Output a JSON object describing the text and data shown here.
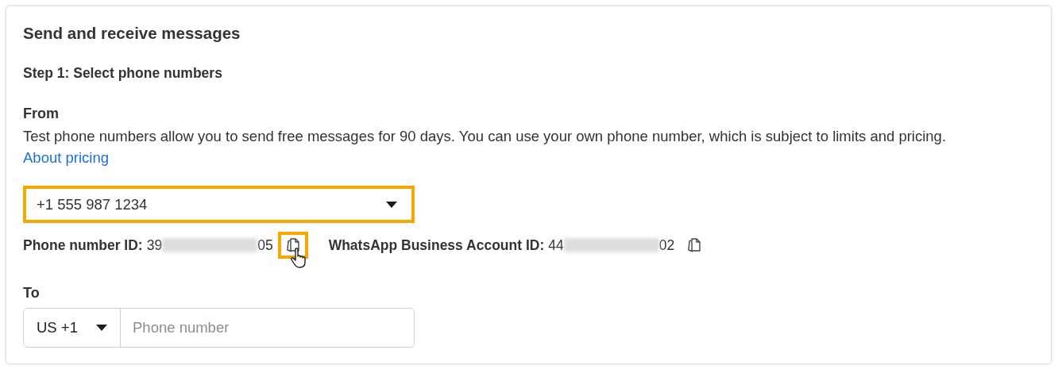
{
  "section": {
    "title": "Send and receive messages"
  },
  "step": "Step 1: Select phone numbers",
  "from": {
    "label": "From",
    "description": "Test phone numbers allow you to send free messages for 90 days. You can use your own phone number, which is subject to limits and pricing.",
    "link": "About pricing",
    "dropdown": {
      "value": "+1 555 987 1234",
      "highlighted": true
    }
  },
  "ids": [
    {
      "label": "Phone number ID:",
      "start": "39",
      "end": "05",
      "copy_highlighted": true,
      "cursor": true
    },
    {
      "label": "WhatsApp Business Account ID:",
      "start": "44",
      "end": "02",
      "copy_highlighted": false,
      "cursor": false
    }
  ],
  "to": {
    "label": "To",
    "country": "US +1",
    "placeholder": "Phone number"
  }
}
